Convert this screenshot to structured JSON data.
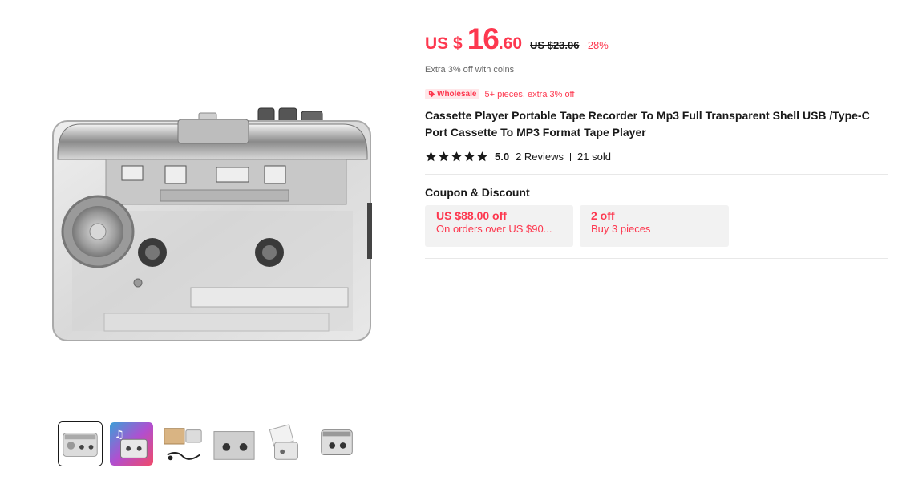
{
  "product": {
    "main_image_icon": "cassette-player-image",
    "thumbnails": [
      {
        "icon": "cassette-player-thumb",
        "active": true
      },
      {
        "icon": "cassette-music-thumb",
        "active": false
      },
      {
        "icon": "package-contents-thumb",
        "active": false
      },
      {
        "icon": "cassette-closeup-thumb",
        "active": false
      },
      {
        "icon": "cassette-open-thumb",
        "active": false
      },
      {
        "icon": "cassette-angle-thumb",
        "active": false
      }
    ],
    "price": {
      "currency": "US $",
      "integer": "16",
      "decimal": ".60",
      "original": "US $23.06",
      "discount": "-28%"
    },
    "coins_text": "Extra 3% off with coins",
    "wholesale": {
      "badge": "Wholesale",
      "text": "5+ pieces, extra 3% off"
    },
    "title": "Cassette Player Portable Tape Recorder To Mp3 Full Transparent Shell USB /Type-C Port Cassette To MP3 Format Tape Player",
    "rating": {
      "score": "5.0",
      "stars": 5,
      "reviews": "2 Reviews",
      "sold": "21 sold"
    },
    "coupon_section": {
      "title": "Coupon & Discount",
      "coupons": [
        {
          "headline": "US $88.00 off",
          "detail": "On orders over US $90..."
        },
        {
          "headline": "2 off",
          "detail": "Buy 3 pieces"
        }
      ]
    }
  },
  "colors": {
    "accent": "#fd384f",
    "text": "#191919",
    "muted": "#666666",
    "coupon_bg": "#f2f2f2"
  }
}
